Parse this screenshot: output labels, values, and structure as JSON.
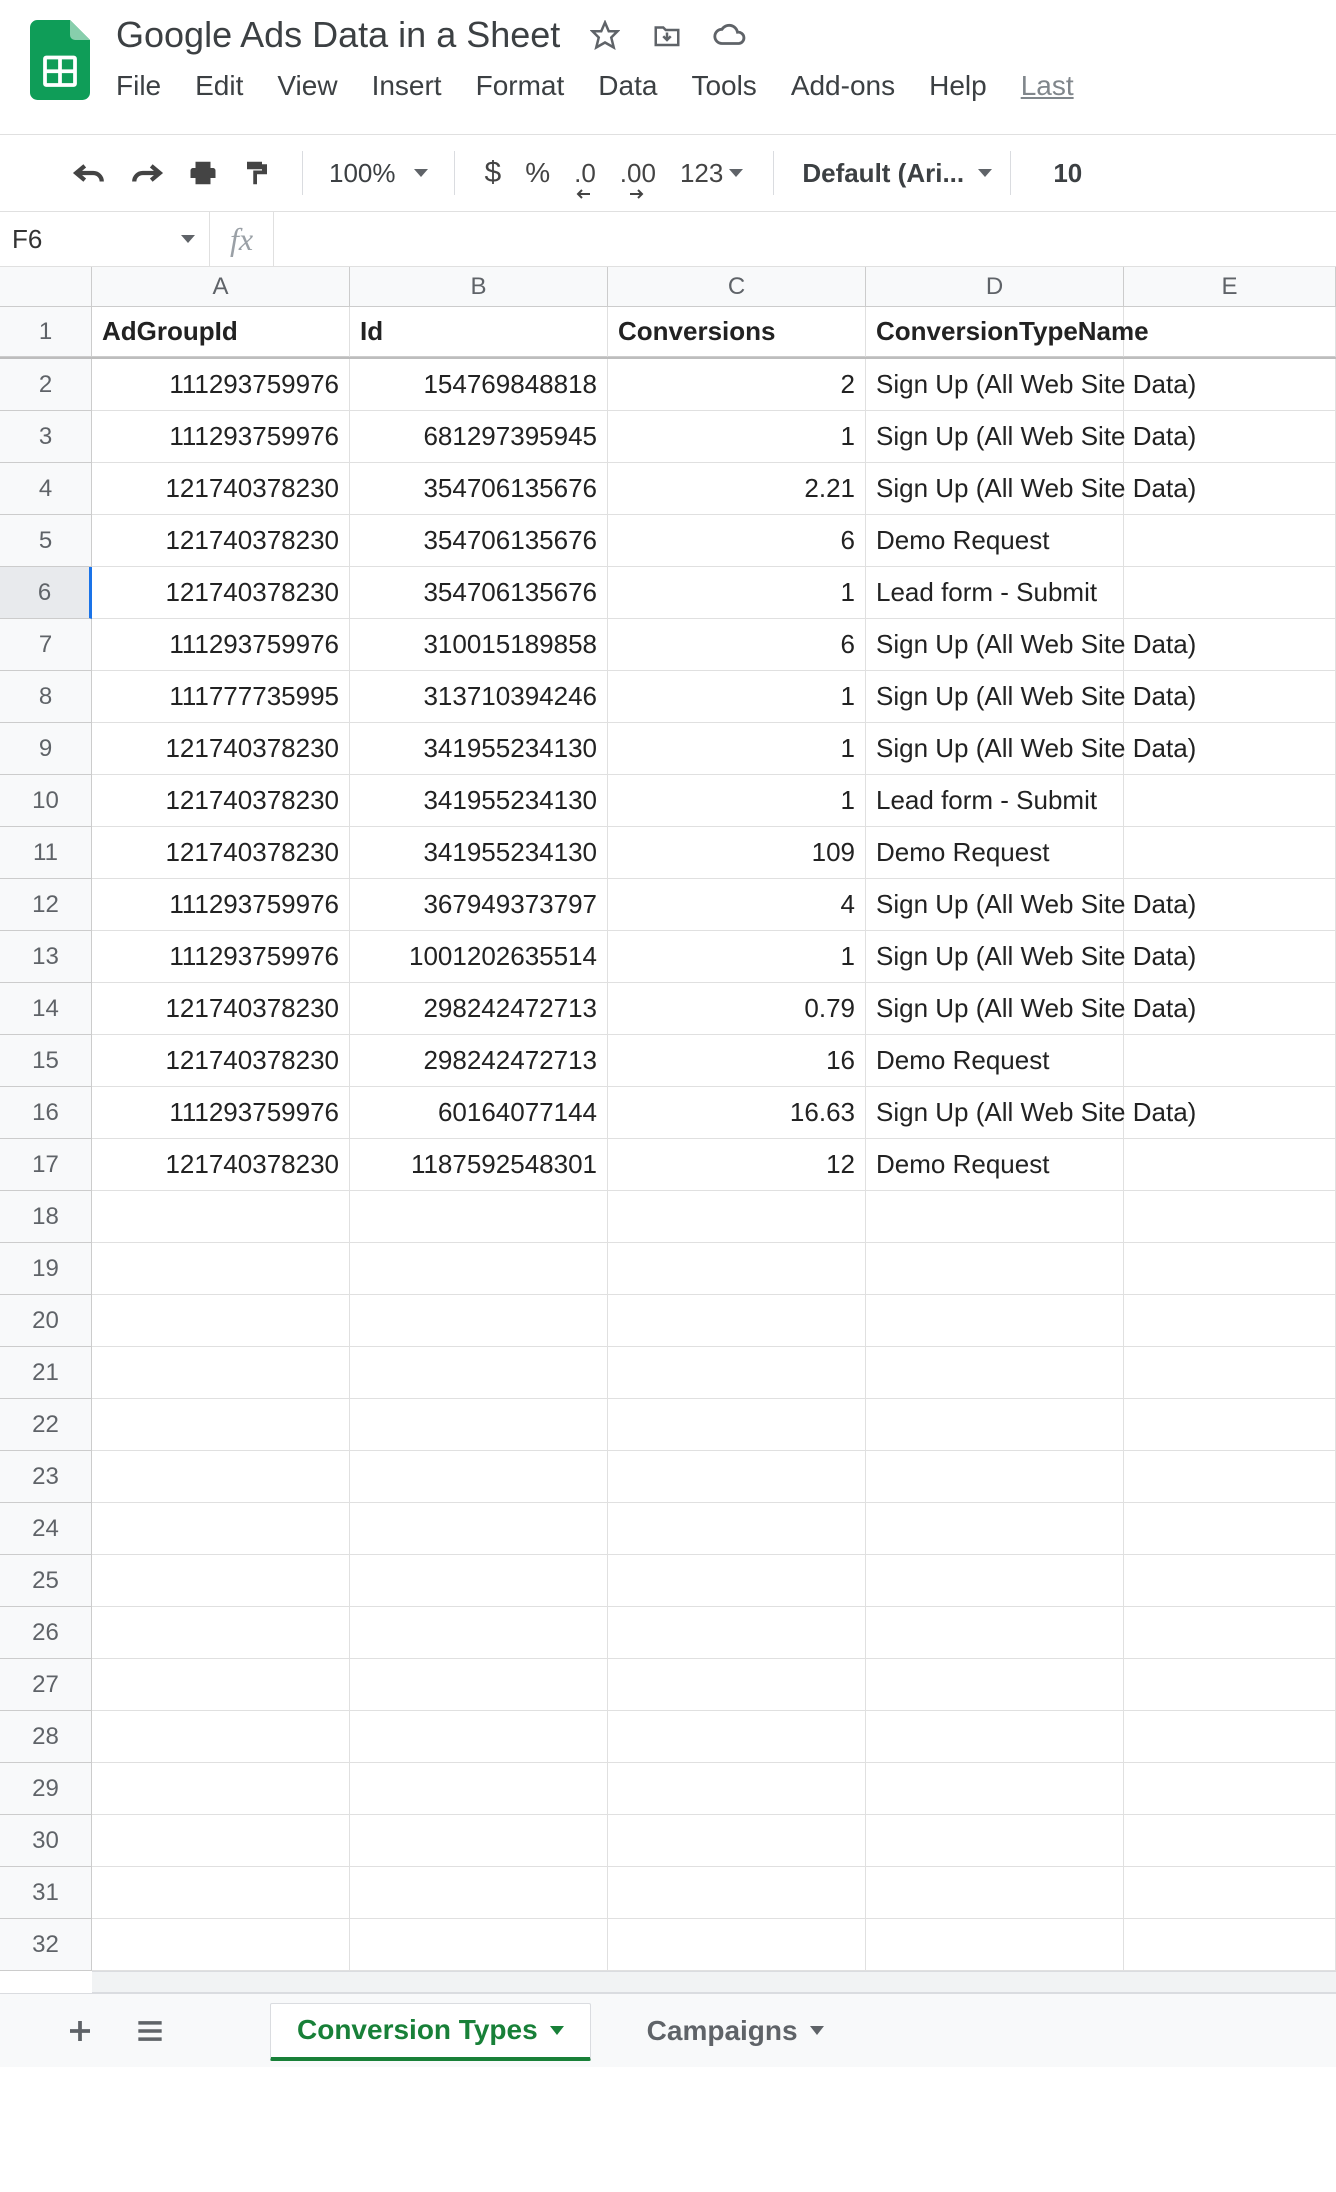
{
  "doc": {
    "title": "Google Ads Data in a Sheet"
  },
  "menus": {
    "file": "File",
    "edit": "Edit",
    "view": "View",
    "insert": "Insert",
    "format": "Format",
    "data": "Data",
    "tools": "Tools",
    "addons": "Add-ons",
    "help": "Help",
    "last": "Last"
  },
  "toolbar": {
    "zoom": "100%",
    "currency": "$",
    "percent": "%",
    "dec_minus": ".0",
    "dec_plus": ".00",
    "num_fmt": "123",
    "font": "Default (Ari...",
    "font_size": "10"
  },
  "fx": {
    "cell_ref": "F6",
    "symbol": "fx"
  },
  "columns": [
    "A",
    "B",
    "C",
    "D",
    "E"
  ],
  "headers": {
    "A": "AdGroupId",
    "B": "Id",
    "C": "Conversions",
    "D": "ConversionTypeName"
  },
  "rows": [
    {
      "n": "1",
      "A": "AdGroupId",
      "B": "Id",
      "C": "Conversions",
      "D": "ConversionTypeName",
      "hdr": true
    },
    {
      "n": "2",
      "A": "111293759976",
      "B": "154769848818",
      "C": "2",
      "D": "Sign Up (All Web Site Data)"
    },
    {
      "n": "3",
      "A": "111293759976",
      "B": "681297395945",
      "C": "1",
      "D": "Sign Up (All Web Site Data)"
    },
    {
      "n": "4",
      "A": "121740378230",
      "B": "354706135676",
      "C": "2.21",
      "D": "Sign Up (All Web Site Data)"
    },
    {
      "n": "5",
      "A": "121740378230",
      "B": "354706135676",
      "C": "6",
      "D": "Demo Request"
    },
    {
      "n": "6",
      "A": "121740378230",
      "B": "354706135676",
      "C": "1",
      "D": "Lead form - Submit"
    },
    {
      "n": "7",
      "A": "111293759976",
      "B": "310015189858",
      "C": "6",
      "D": "Sign Up (All Web Site Data)"
    },
    {
      "n": "8",
      "A": "111777735995",
      "B": "313710394246",
      "C": "1",
      "D": "Sign Up (All Web Site Data)"
    },
    {
      "n": "9",
      "A": "121740378230",
      "B": "341955234130",
      "C": "1",
      "D": "Sign Up (All Web Site Data)"
    },
    {
      "n": "10",
      "A": "121740378230",
      "B": "341955234130",
      "C": "1",
      "D": "Lead form - Submit"
    },
    {
      "n": "11",
      "A": "121740378230",
      "B": "341955234130",
      "C": "109",
      "D": "Demo Request"
    },
    {
      "n": "12",
      "A": "111293759976",
      "B": "367949373797",
      "C": "4",
      "D": "Sign Up (All Web Site Data)"
    },
    {
      "n": "13",
      "A": "111293759976",
      "B": "1001202635514",
      "C": "1",
      "D": "Sign Up (All Web Site Data)"
    },
    {
      "n": "14",
      "A": "121740378230",
      "B": "298242472713",
      "C": "0.79",
      "D": "Sign Up (All Web Site Data)"
    },
    {
      "n": "15",
      "A": "121740378230",
      "B": "298242472713",
      "C": "16",
      "D": "Demo Request"
    },
    {
      "n": "16",
      "A": "111293759976",
      "B": "60164077144",
      "C": "16.63",
      "D": "Sign Up (All Web Site Data)"
    },
    {
      "n": "17",
      "A": "121740378230",
      "B": "1187592548301",
      "C": "12",
      "D": "Demo Request"
    },
    {
      "n": "18"
    },
    {
      "n": "19"
    },
    {
      "n": "20"
    },
    {
      "n": "21"
    },
    {
      "n": "22"
    },
    {
      "n": "23"
    },
    {
      "n": "24"
    },
    {
      "n": "25"
    },
    {
      "n": "26"
    },
    {
      "n": "27"
    },
    {
      "n": "28"
    },
    {
      "n": "29"
    },
    {
      "n": "30"
    },
    {
      "n": "31"
    },
    {
      "n": "32"
    }
  ],
  "selected": {
    "row": 6,
    "col": "F"
  },
  "tabs": {
    "active": "Conversion Types",
    "inactive": "Campaigns"
  }
}
